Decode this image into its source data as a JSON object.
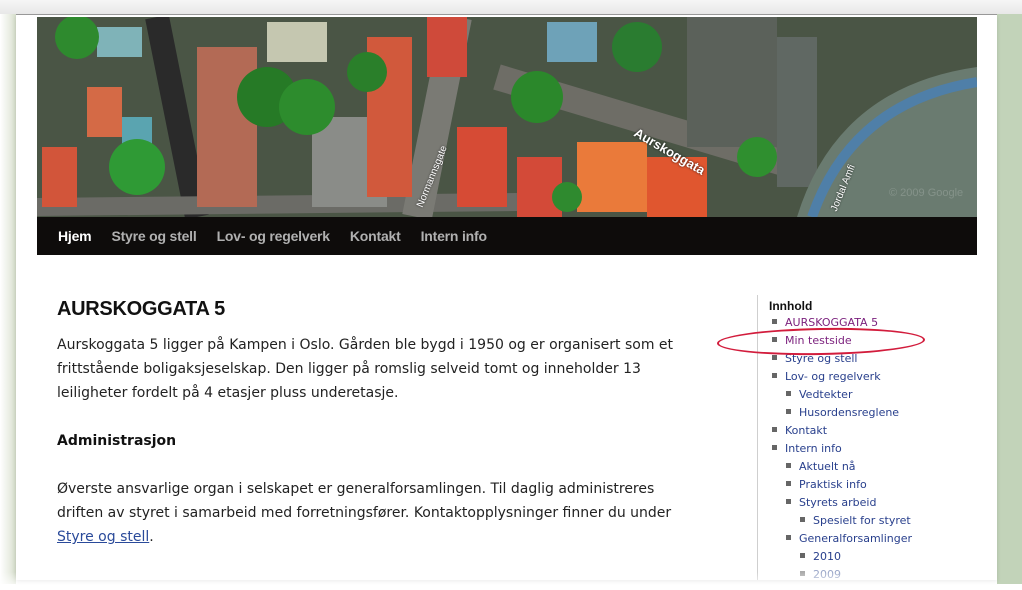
{
  "banner": {
    "map_labels": {
      "aurskoggata": "Aurskoggata",
      "normannsgate": "Normannsgate",
      "jordal": "Jordal Amfi",
      "copyright": "© 2009 Google"
    }
  },
  "nav": {
    "items": [
      {
        "label": "Hjem",
        "active": true
      },
      {
        "label": "Styre og stell",
        "active": false
      },
      {
        "label": "Lov- og regelverk",
        "active": false
      },
      {
        "label": "Kontakt",
        "active": false
      },
      {
        "label": "Intern info",
        "active": false
      }
    ]
  },
  "main": {
    "title": "AURSKOGGATA 5",
    "intro": "Aurskoggata 5 ligger på Kampen i Oslo. Gården ble bygd i 1950 og er organisert som et frittstående boligaksjeselskap. Den ligger på romslig selveid tomt og inneholder 13 leiligheter fordelt på 4 etasjer pluss underetasje.",
    "admin_heading": "Administrasjon",
    "admin_text": "Øverste ansvarlige organ i selskapet er generalforsamlingen. Til daglig administreres driften av styret i samarbeid med forretningsfører. Kontaktopplysninger finner du under ",
    "admin_link": "Styre og stell",
    "admin_end": "."
  },
  "sidebar": {
    "title": "Innhold",
    "items": [
      {
        "label": "AURSKOGGATA 5",
        "level": 1,
        "state": "visited"
      },
      {
        "label": "Min testside",
        "level": 1,
        "state": "visited",
        "highlighted": true
      },
      {
        "label": "Styre og stell",
        "level": 1,
        "state": "link"
      },
      {
        "label": "Lov- og regelverk",
        "level": 1,
        "state": "link"
      },
      {
        "label": "Vedtekter",
        "level": 2,
        "state": "link"
      },
      {
        "label": "Husordensreglene",
        "level": 2,
        "state": "link"
      },
      {
        "label": "Kontakt",
        "level": 1,
        "state": "link"
      },
      {
        "label": "Intern info",
        "level": 1,
        "state": "link"
      },
      {
        "label": "Aktuelt nå",
        "level": 2,
        "state": "link"
      },
      {
        "label": "Praktisk info",
        "level": 2,
        "state": "link"
      },
      {
        "label": "Styrets arbeid",
        "level": 2,
        "state": "link"
      },
      {
        "label": "Spesielt for styret",
        "level": 3,
        "state": "link"
      },
      {
        "label": "Generalforsamlinger",
        "level": 2,
        "state": "link"
      },
      {
        "label": "2010",
        "level": 3,
        "state": "link"
      },
      {
        "label": "2009",
        "level": 3,
        "state": "faded"
      }
    ]
  },
  "colors": {
    "nav_bg": "#0e0c0b",
    "link": "#283f8c",
    "visited": "#7a1f7c",
    "annotation": "#d21c3c",
    "side_panel": "#c2d3b9"
  }
}
